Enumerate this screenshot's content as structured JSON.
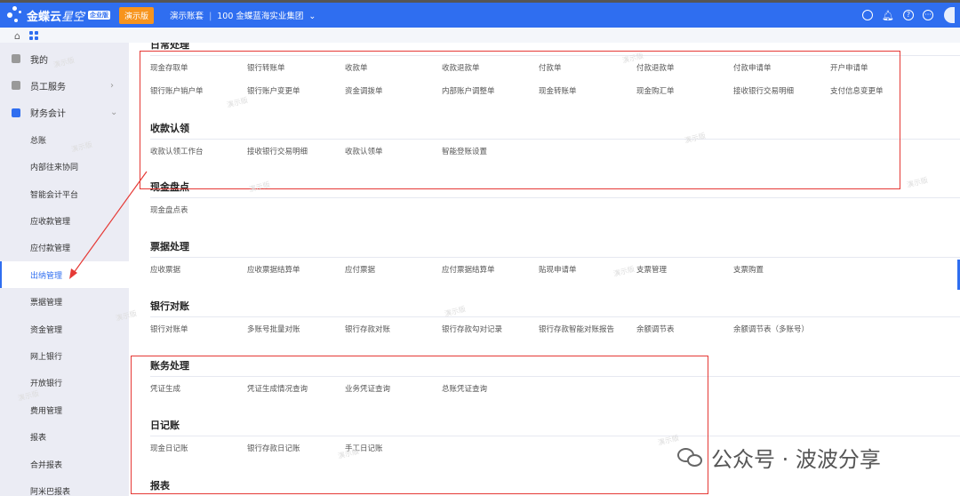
{
  "header": {
    "brand": "金蝶云",
    "brand_sub": "星空",
    "edition_badge": "企业版",
    "demo_badge": "演示版",
    "account": "演示账套",
    "org": "100 金蝶蓝海实业集团"
  },
  "sidebar": {
    "items": [
      {
        "label": "我的",
        "top": true
      },
      {
        "label": "员工服务",
        "top": true,
        "chevron": "›"
      },
      {
        "label": "财务会计",
        "top": true,
        "chevron": "⌄",
        "active_group": true
      },
      {
        "label": "总账"
      },
      {
        "label": "内部往来协同"
      },
      {
        "label": "智能会计平台"
      },
      {
        "label": "应收款管理"
      },
      {
        "label": "应付款管理"
      },
      {
        "label": "出纳管理",
        "active": true
      },
      {
        "label": "票据管理"
      },
      {
        "label": "资金管理"
      },
      {
        "label": "网上银行"
      },
      {
        "label": "开放银行"
      },
      {
        "label": "费用管理"
      },
      {
        "label": "报表"
      },
      {
        "label": "合并报表"
      },
      {
        "label": "阿米巴报表"
      }
    ]
  },
  "sections": [
    {
      "title": "日常处理",
      "rows": [
        [
          "现金存取单",
          "银行转账单",
          "收款单",
          "收款退款单",
          "付款单",
          "付款退款单",
          "付款申请单",
          "开户申请单"
        ],
        [
          "银行账户销户单",
          "银行账户变更单",
          "资金调拨单",
          "内部账户调整单",
          "现金转账单",
          "现金购汇单",
          "接收银行交易明细",
          "支付信息变更单"
        ]
      ]
    },
    {
      "title": "收款认领",
      "rows": [
        [
          "收款认领工作台",
          "接收银行交易明细",
          "收款认领单",
          "智能登账设置"
        ]
      ]
    },
    {
      "title": "现金盘点",
      "rows": [
        [
          "现金盘点表"
        ]
      ]
    },
    {
      "title": "票据处理",
      "rows": [
        [
          "应收票据",
          "应收票据结算单",
          "应付票据",
          "应付票据结算单",
          "贴现申请单",
          "支票管理",
          "支票购置"
        ]
      ]
    },
    {
      "title": "银行对账",
      "rows": [
        [
          "银行对账单",
          "多账号批量对账",
          "银行存款对账",
          "银行存款勾对记录",
          "银行存款智能对账报告",
          "余额调节表",
          "余额调节表（多账号）"
        ]
      ]
    },
    {
      "title": "账务处理",
      "rows": [
        [
          "凭证生成",
          "凭证生成情况查询",
          "业务凭证查询",
          "总账凭证查询"
        ]
      ]
    },
    {
      "title": "日记账",
      "rows": [
        [
          "现金日记账",
          "银行存款日记账",
          "手工日记账"
        ]
      ]
    },
    {
      "title": "报表",
      "rows": []
    }
  ],
  "watermark": "演示版",
  "brand_overlay": "公众号 · 波波分享",
  "colors": {
    "primary": "#2f6ef0",
    "demo_badge": "#f7941d",
    "annotation": "#e53935",
    "sidebar_bg": "#ebecf4"
  }
}
